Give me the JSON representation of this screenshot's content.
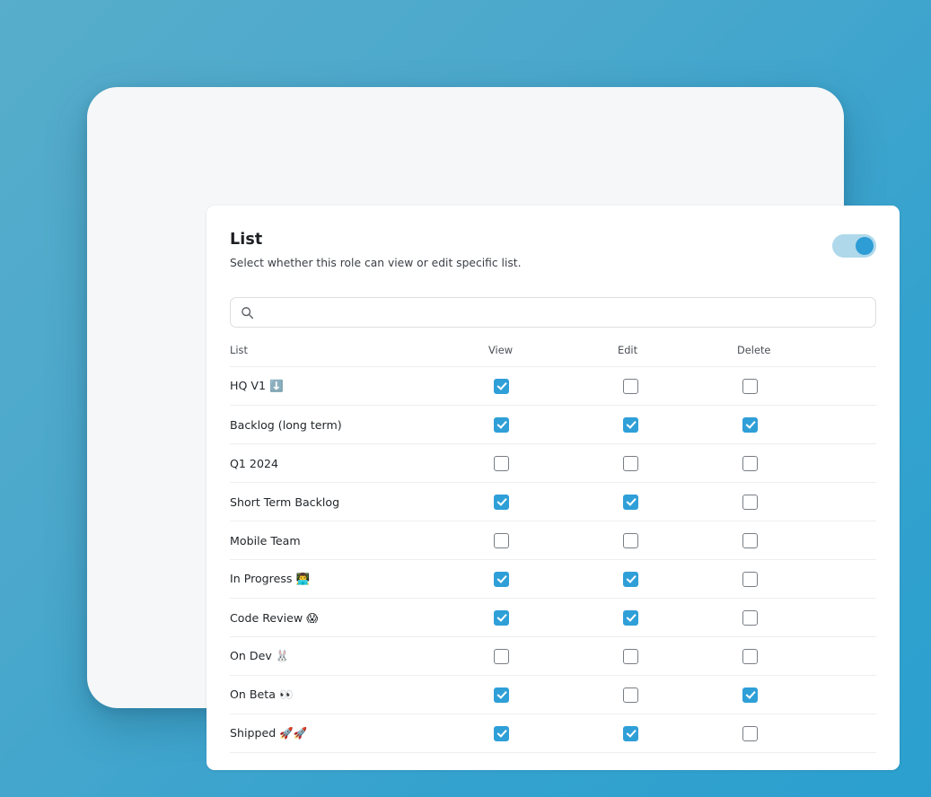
{
  "panel": {
    "title": "List",
    "subtitle": "Select whether this role can view or edit specific list.",
    "toggle": {
      "name": "list-permissions-toggle",
      "state": "on"
    }
  },
  "search": {
    "value": "",
    "placeholder": "",
    "icon": "search-icon"
  },
  "table": {
    "columns": [
      "List",
      "View",
      "Edit",
      "Delete"
    ],
    "rows": [
      {
        "label": "HQ V1 ",
        "emoji": "⬇️",
        "view": true,
        "edit": false,
        "delete": false
      },
      {
        "label": "Backlog (long term)",
        "emoji": "",
        "view": true,
        "edit": true,
        "delete": true
      },
      {
        "label": "Q1 2024",
        "emoji": "",
        "view": false,
        "edit": false,
        "delete": false
      },
      {
        "label": "Short Term Backlog",
        "emoji": "",
        "view": true,
        "edit": true,
        "delete": false
      },
      {
        "label": "Mobile Team",
        "emoji": "",
        "view": false,
        "edit": false,
        "delete": false
      },
      {
        "label": "In Progress ",
        "emoji": "👨‍💻",
        "view": true,
        "edit": true,
        "delete": false
      },
      {
        "label": "Code Review ",
        "emoji": "😱",
        "view": true,
        "edit": true,
        "delete": false
      },
      {
        "label": "On Dev ",
        "emoji": "🐰",
        "view": false,
        "edit": false,
        "delete": false
      },
      {
        "label": "On Beta ",
        "emoji": "👀",
        "view": true,
        "edit": false,
        "delete": true
      },
      {
        "label": "Shipped ",
        "emoji": "🚀🚀",
        "view": true,
        "edit": true,
        "delete": false
      }
    ]
  },
  "colors": {
    "accent": "#2F9FD8",
    "toggle_track": "#AFD8EB",
    "toggle_knob": "#2E9CD5",
    "background_start": "#57ADCB",
    "background_end": "#2BA0CF",
    "outer_card": "#F6F7F8",
    "inner_card": "#FFFFFF",
    "row_divider": "#EDEEEF"
  }
}
